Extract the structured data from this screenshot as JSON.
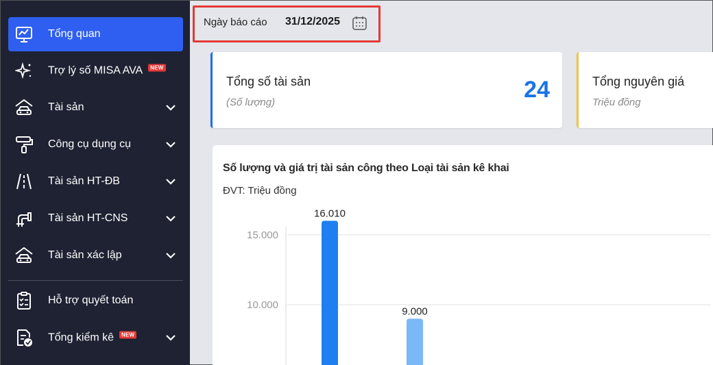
{
  "sidebar": {
    "items": [
      {
        "label": "Tổng quan",
        "icon": "chart-monitor-icon",
        "active": true,
        "badge": "",
        "chevron": false
      },
      {
        "label": "Trợ lý số MISA AVA",
        "icon": "sparkle-icon",
        "active": false,
        "badge": "NEW",
        "chevron": false
      },
      {
        "label": "Tài sản",
        "icon": "car-house-icon",
        "active": false,
        "badge": "",
        "chevron": true
      },
      {
        "label": "Công cụ dụng cụ",
        "icon": "paint-roller-icon",
        "active": false,
        "badge": "",
        "chevron": true
      },
      {
        "label": "Tài sản HT-ĐB",
        "icon": "road-icon",
        "active": false,
        "badge": "",
        "chevron": true
      },
      {
        "label": "Tài sản HT-CNS",
        "icon": "pipe-icon",
        "active": false,
        "badge": "",
        "chevron": true
      },
      {
        "label": "Tài sản xác lập",
        "icon": "car-house-icon",
        "active": false,
        "badge": "",
        "chevron": true
      },
      {
        "label": "Hỗ trợ quyết toán",
        "icon": "clipboard-check-icon",
        "active": false,
        "badge": "",
        "chevron": false
      },
      {
        "label": "Tổng kiểm kê",
        "icon": "doc-check-icon",
        "active": false,
        "badge": "NEW",
        "chevron": true
      }
    ]
  },
  "report_date": {
    "label": "Ngày báo cáo",
    "value": "31/12/2025"
  },
  "cards": {
    "total_assets": {
      "title": "Tổng số tài sản",
      "subtitle": "(Số lượng)",
      "value": "24",
      "accent": "#1e6fe8"
    },
    "total_cost": {
      "title": "Tổng nguyên giá",
      "subtitle": "Triệu đồng",
      "accent": "#f5c33b"
    }
  },
  "chart": {
    "title": "Số lượng và giá trị tài sản công theo Loại tài sản kê khai",
    "unit": "ĐVT: Triệu đồng"
  },
  "chart_data": {
    "type": "bar",
    "title": "Số lượng và giá trị tài sản công theo Loại tài sản kê khai",
    "ylabel": "ĐVT: Triệu đồng",
    "yticks": [
      "10.000",
      "15.000"
    ],
    "ytick_values": [
      10000,
      15000
    ],
    "series_values": [
      16010,
      9000
    ],
    "data_labels": [
      "16.010",
      "9.000"
    ],
    "colors": [
      "#1e7ff0",
      "#7ab8f7"
    ],
    "grid": true
  },
  "colors": {
    "sidebar_bg": "#1e2232",
    "active_bg": "#2f5ff0",
    "highlight_border": "#e53935",
    "accent_blue": "#1a73e8"
  }
}
